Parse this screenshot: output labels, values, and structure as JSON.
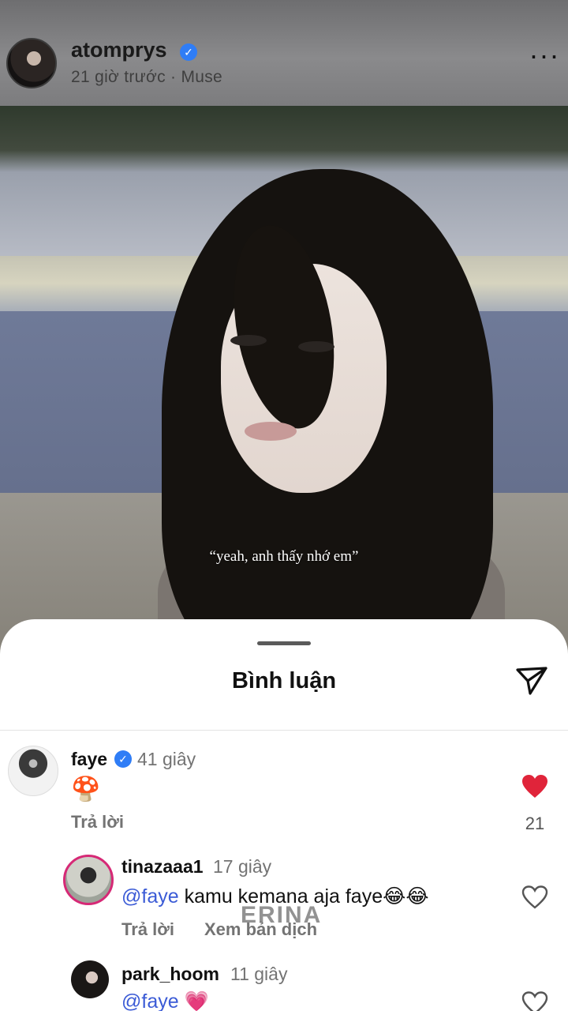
{
  "post": {
    "username": "atomprys",
    "verified": true,
    "subtitle": "21 giờ trước · Muse",
    "more_icon": "more-horizontal-icon",
    "caption": "“yeah, anh thấy nhớ em”"
  },
  "comments_sheet": {
    "title": "Bình luận",
    "share_icon": "send-icon",
    "watermark": "ERINA",
    "comments": [
      {
        "username": "faye",
        "verified": true,
        "time": "41 giây",
        "text": "🍄",
        "reply_label": "Trả lời",
        "liked": true,
        "like_count": "21"
      },
      {
        "username": "tinazaaa1",
        "time": "17 giây",
        "mention": "@faye",
        "text": " kamu kemana aja faye😂😂",
        "reply_label": "Trả lời",
        "translate_label": "Xem bản dịch",
        "liked": false
      },
      {
        "username": "park_hoom",
        "time": "11 giây",
        "mention": "@faye",
        "text": " 💗",
        "liked": false
      }
    ]
  },
  "colors": {
    "accent_blue": "#2f7df6",
    "mention_blue": "#3b5bd6",
    "like_red": "#e0243a"
  }
}
